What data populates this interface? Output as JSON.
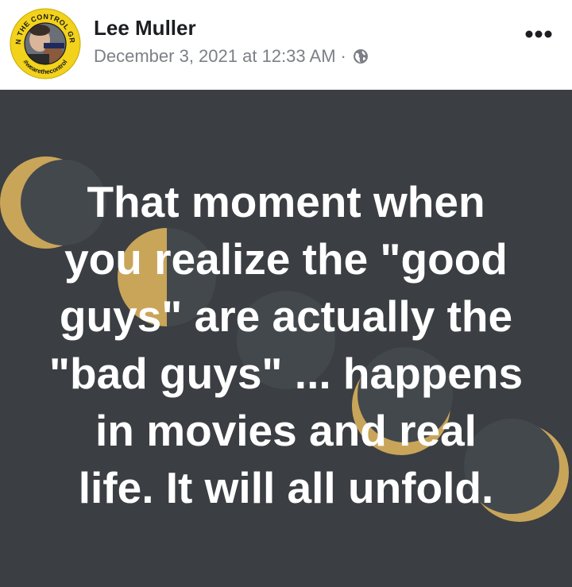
{
  "post": {
    "author": "Lee Muller",
    "date": "December 3, 2021 at 12:33 AM",
    "separator": "·",
    "privacy_icon": "globe-icon",
    "more_icon": "more-options-icon",
    "avatar_ring_text_top": "I'M IN THE CONTROL GROUP",
    "avatar_ring_text_bottom": "#wearethecontrol",
    "text": "That moment when\nyou realize the \"good\nguys\" are actually the\n\"bad guys\" ... happens\nin movies and real\nlife. It will all unfold."
  },
  "colors": {
    "post_background": "#3b3e42",
    "moon_gold": "#c9a55a",
    "moon_shadow": "#43484d",
    "avatar_ring": "#f2d21b"
  }
}
